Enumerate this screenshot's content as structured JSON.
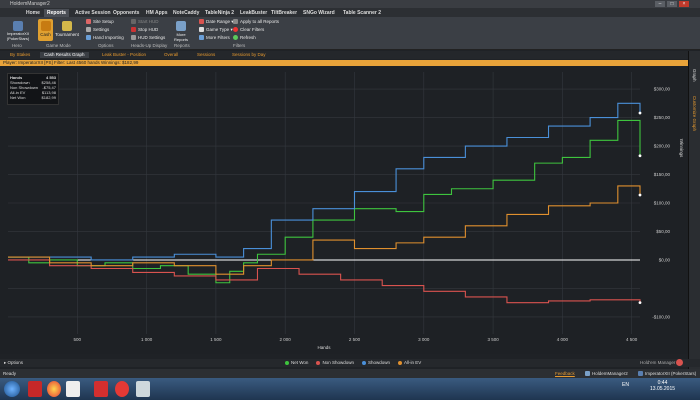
{
  "window": {
    "title": "HoldemManager2"
  },
  "menu_tabs": [
    "Home",
    "Reports",
    "Active Session",
    "Opponents",
    "HM Apps",
    "NoteCaddy",
    "TableNinja 2",
    "LeakBuster",
    "TiltBreaker",
    "SNGo Wizard",
    "Table Scanner 2"
  ],
  "active_tab": "Reports",
  "ribbon": {
    "hero_name": "ImperatorXII (PokerStars)",
    "hero_label": "Hero",
    "cash_label": "Cash",
    "tournament_label": "Tournament",
    "game_mode_label": "Game Mode",
    "site_setup": "Site Setup",
    "settings": "Settings",
    "hand_importing": "Hand Importing",
    "options_label": "Options",
    "start_hud": "Start HUD",
    "stop_hud": "Stop HUD",
    "hud_settings": "HUD Settings",
    "heads_up_display_label": "Heads-Up Display",
    "more_reports": "More Reports",
    "reports_label": "Reports",
    "date_range": "Date Range",
    "apply_all_reports": "Apply to all Reports",
    "game_type": "Game Type",
    "clear_filters": "Clear Filters",
    "more_filters": "More Filters",
    "refresh": "Refresh",
    "filters_label": "Filters"
  },
  "sub_tabs": [
    "By Stakes",
    "Cash Results Graph",
    "Leak Buster - Position",
    "Overall",
    "Sessions",
    "Sessions by Day"
  ],
  "active_sub_tab": "Cash Results Graph",
  "filter_text": "Player: ImperatorXII [PS] Filter: Last 4560 hands Winnings: $182,99",
  "stats": {
    "header_label": "Hands",
    "header_value": "4 553",
    "rows": [
      {
        "label": "Showdown",
        "value": "$258,46"
      },
      {
        "label": "Non Showdown",
        "value": "-$75,47"
      },
      {
        "label": "All-in EV",
        "value": "$113,98"
      },
      {
        "label": "Net Won",
        "value": "$182,99"
      }
    ]
  },
  "right_panel": {
    "graph": "Graph",
    "customize": "Customize Graph"
  },
  "chart_data": {
    "type": "line",
    "xlabel": "Hands",
    "ylabel": "Winnings",
    "xlim": [
      0,
      4560
    ],
    "ylim": [
      -130,
      330
    ],
    "x_ticks": [
      500,
      1000,
      1500,
      2000,
      2500,
      3000,
      3500,
      4000,
      4500
    ],
    "x_tick_labels": [
      "500",
      "1 000",
      "1 500",
      "2 000",
      "2 500",
      "3 000",
      "3 500",
      "4 000",
      "4 500"
    ],
    "y_ticks": [
      -100,
      -50,
      0,
      50,
      100,
      150,
      200,
      250,
      300
    ],
    "y_tick_labels": [
      "-$100,00",
      "",
      "$0,00",
      "$50,00",
      "$100,00",
      "$150,00",
      "$200,00",
      "$250,00",
      "$300,00"
    ],
    "zero_line": 0,
    "series": [
      {
        "name": "Net Won",
        "color": "#3ec43e",
        "x": [
          0,
          150,
          300,
          500,
          700,
          900,
          1100,
          1300,
          1500,
          1600,
          1700,
          1800,
          2000,
          2200,
          2500,
          2800,
          3000,
          3200,
          3500,
          3800,
          4000,
          4200,
          4400,
          4560
        ],
        "y": [
          5,
          -5,
          0,
          -10,
          -5,
          -15,
          -10,
          -25,
          -40,
          -20,
          -5,
          10,
          40,
          70,
          90,
          85,
          115,
          125,
          140,
          170,
          180,
          210,
          245,
          183
        ]
      },
      {
        "name": "Non Showdown",
        "color": "#d9534f",
        "x": [
          0,
          300,
          600,
          900,
          1200,
          1500,
          1800,
          2100,
          2400,
          2700,
          3000,
          3300,
          3600,
          3900,
          4200,
          4560
        ],
        "y": [
          0,
          -10,
          -15,
          -22,
          -28,
          -35,
          -15,
          -25,
          -35,
          -45,
          -55,
          -65,
          -75,
          -72,
          -70,
          -75
        ]
      },
      {
        "name": "Showdown",
        "color": "#4a90d9",
        "x": [
          0,
          300,
          600,
          900,
          1200,
          1500,
          1700,
          1900,
          2200,
          2500,
          2800,
          3000,
          3300,
          3600,
          3900,
          4200,
          4400,
          4560
        ],
        "y": [
          5,
          5,
          0,
          5,
          10,
          5,
          20,
          70,
          90,
          120,
          160,
          180,
          200,
          215,
          235,
          250,
          275,
          258
        ]
      },
      {
        "name": "All-in EV",
        "color": "#e0902e",
        "x": [
          0,
          300,
          600,
          900,
          1200,
          1500,
          1700,
          1900,
          2200,
          2500,
          2800,
          3000,
          3300,
          3600,
          3900,
          4200,
          4400,
          4560
        ],
        "y": [
          5,
          -5,
          -10,
          -5,
          -10,
          -25,
          -10,
          0,
          35,
          20,
          30,
          40,
          60,
          80,
          95,
          100,
          130,
          114
        ]
      }
    ]
  },
  "legend_items": [
    "Net Won",
    "Non Showdown",
    "Showdown",
    "All-in EV"
  ],
  "footer": {
    "options": "Options",
    "branding": "Hold'em Manager 2",
    "status": "Ready",
    "feedback": "Feedback",
    "db_name": "HoldemManager2",
    "player": "ImperatorXII (PokerStars)"
  },
  "taskbar": {
    "lang": "EN",
    "time": "0:44",
    "date": "13.05.2015"
  }
}
